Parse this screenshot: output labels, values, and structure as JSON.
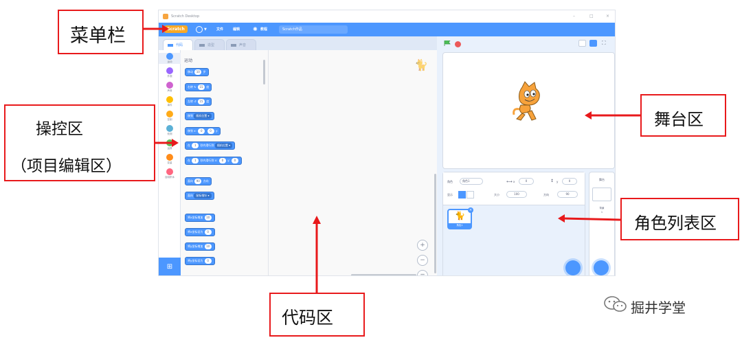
{
  "window": {
    "title": "Scratch Desktop",
    "controls": [
      "–",
      "□",
      "×"
    ]
  },
  "menubar": {
    "brand": "Scratch",
    "file_label": "文件",
    "edit_label": "编辑",
    "tutorials_label": "教程",
    "project_title": "Scratch作品"
  },
  "tabs": [
    {
      "label": "代码"
    },
    {
      "label": "造型"
    },
    {
      "label": "声音"
    }
  ],
  "categories": [
    {
      "label": "运动",
      "color": "#4c97ff"
    },
    {
      "label": "外观",
      "color": "#9966ff"
    },
    {
      "label": "声音",
      "color": "#cf63cf"
    },
    {
      "label": "事件",
      "color": "#ffbf00"
    },
    {
      "label": "控制",
      "color": "#ffab19"
    },
    {
      "label": "侦测",
      "color": "#5cb1d6"
    },
    {
      "label": "运算",
      "color": "#59c059"
    },
    {
      "label": "变量",
      "color": "#ff8c1a"
    },
    {
      "label": "自制积木",
      "color": "#ff6680"
    }
  ],
  "palette": {
    "section_title": "运动",
    "blocks": [
      {
        "pre": "移动",
        "val": "10",
        "post": "步"
      },
      {
        "pre": "右转 ↻",
        "val": "15",
        "post": "度"
      },
      {
        "pre": "左转 ↺",
        "val": "15",
        "post": "度"
      },
      {
        "pre": "移到",
        "dd": "随机位置 ▾"
      },
      {
        "pre": "移到 x:",
        "val": "0",
        "mid": "y:",
        "val2": "0"
      },
      {
        "pre": "在",
        "val": "1",
        "post": "秒内滑行到",
        "dd": "随机位置 ▾"
      },
      {
        "pre": "在",
        "val": "1",
        "post": "秒内滑行到 x:",
        "val2": "0",
        "mid": "y:",
        "val3": "0"
      },
      {
        "pre": "面向",
        "val": "90",
        "post": "方向"
      },
      {
        "pre": "面向",
        "dd": "鼠标指针 ▾"
      },
      {
        "pre": "将x坐标增加",
        "val": "10"
      },
      {
        "pre": "将x坐标设为",
        "val": "0"
      },
      {
        "pre": "将y坐标增加",
        "val": "10"
      },
      {
        "pre": "将y坐标设为",
        "val": "0"
      }
    ]
  },
  "code_area": {
    "zoom_in": "+",
    "zoom_out": "−",
    "zoom_reset": "="
  },
  "sprite_info": {
    "sprite_label": "角色",
    "sprite_name": "角色1",
    "x_label": "x",
    "x_value": "0",
    "y_label": "y",
    "y_value": "0",
    "show_label": "显示",
    "size_label": "大小",
    "size_value": "100",
    "direction_label": "方向",
    "direction_value": "90"
  },
  "sprite_list": [
    {
      "name": "角色1"
    }
  ],
  "stage_pane": {
    "header": "舞台",
    "backdrops_label": "背景",
    "backdrops_count": "1"
  },
  "annotations": {
    "menubar": "菜单栏",
    "control_line1": "操控区",
    "control_line2": "（项目编辑区）",
    "stage": "舞台区",
    "sprite_list": "角色列表区",
    "code": "代码区"
  },
  "watermark": "掘井学堂",
  "colors": {
    "accent": "#4c97ff",
    "annotation_red": "#e8191b",
    "menubar_brand": "#f9a825"
  }
}
